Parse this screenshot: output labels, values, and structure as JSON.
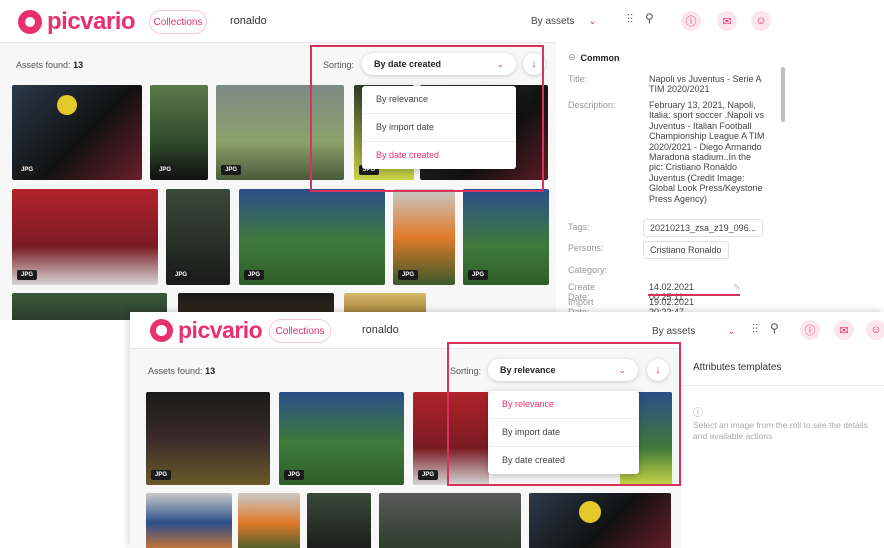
{
  "app": {
    "logo_text": "picvario",
    "brand_color": "#e8306f",
    "highlight_color": "#d9335d"
  },
  "top": {
    "collections_label": "Collections",
    "search_value": "ronaldo",
    "scope_label": "By assets",
    "filter_icon": "sliders-icon",
    "search_icon": "search-icon",
    "info_icon": "info-icon",
    "inbox_icon": "inbox-icon",
    "user_icon": "user-icon"
  },
  "shot1": {
    "assets_found_label": "Assets found:",
    "assets_found_count": "13",
    "sorting_label": "Sorting:",
    "sort_selected": "By date created",
    "sort_options": [
      "By relevance",
      "By import date",
      "By date created"
    ],
    "sort_active_index": 2,
    "file_type": "JPG",
    "panel": {
      "section_title": "Common",
      "title_label": "Title:",
      "title_value": "Napoli vs Juventus - Serie A TIM 2020/2021",
      "description_label": "Description:",
      "description_value": "February 13, 2021, Napoli, Italia: sport soccer .Napoli vs Juventus - Italian Football Championship League A TIM 2020/2021 - Diego Armando Maradona stadium..In the pic: Cristiano Ronaldo Juventus (Credit Image: Global Look Press/Keystone Press Agency)",
      "tags_label": "Tags:",
      "tags_value": "20210213_zsa_z19_096...",
      "persons_label": "Persons:",
      "persons_value": "Cristiano Ronaldo",
      "category_label": "Category:",
      "create_date_label": "Create Date:",
      "create_date_value": "14.02.2021 00:25:11",
      "import_date_label": "Import Date:",
      "import_date_value": "19.02.2021 20:22:47"
    }
  },
  "shot2": {
    "assets_found_label": "Assets found:",
    "assets_found_count": "13",
    "sorting_label": "Sorting:",
    "sort_selected": "By relevance",
    "sort_options": [
      "By relevance",
      "By import date",
      "By date created"
    ],
    "sort_active_index": 0,
    "file_type": "JPG",
    "panel": {
      "title": "Attributes templates",
      "empty_message": "Select an image from the roll to see the details and available actions"
    }
  }
}
